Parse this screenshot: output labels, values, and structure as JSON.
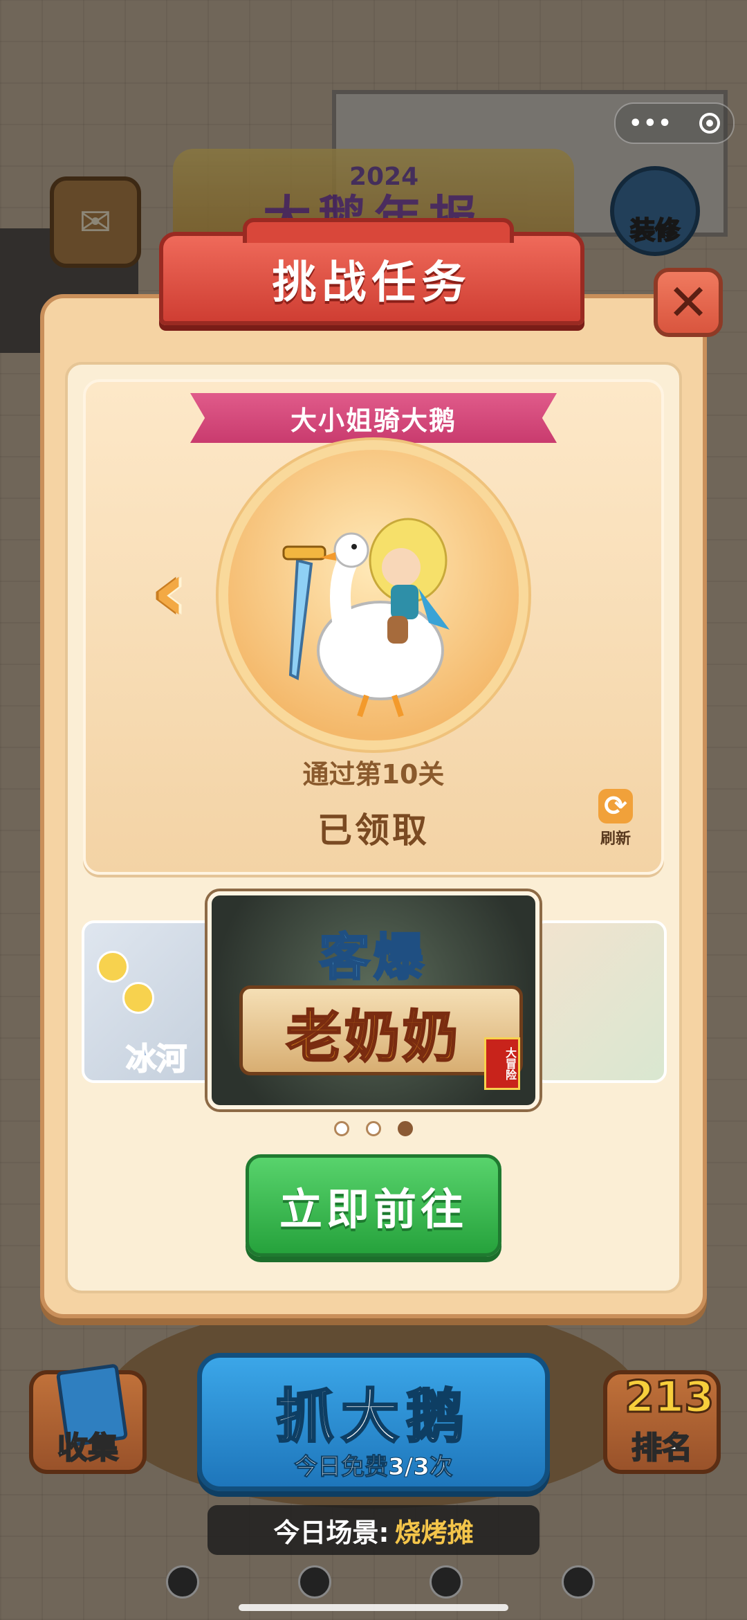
{
  "background": {
    "banner_year": "2024",
    "banner_title": "大鹅年报",
    "renovate_label": "装修"
  },
  "modal": {
    "title": "挑战任务",
    "close_icon": "close-x-icon",
    "task": {
      "name": "大小姐骑大鹅",
      "requirement": "通过第10关",
      "status": "已领取",
      "refresh_label": "刷新"
    },
    "carousel": {
      "left_label": "冰河",
      "center_logo_top": "客爆",
      "center_logo_main": "老奶奶",
      "center_tag": "大冒险",
      "dots_total": 3,
      "active_dot": 3
    },
    "go_button": "立即前往"
  },
  "hud": {
    "collect_label": "收集",
    "rank_label": "排名",
    "rank_digits": "213",
    "catch_title": "抓大鹅",
    "catch_sub": "今日免费3/3次",
    "scene_key": "今日场景:",
    "scene_value": "烧烤摊"
  }
}
